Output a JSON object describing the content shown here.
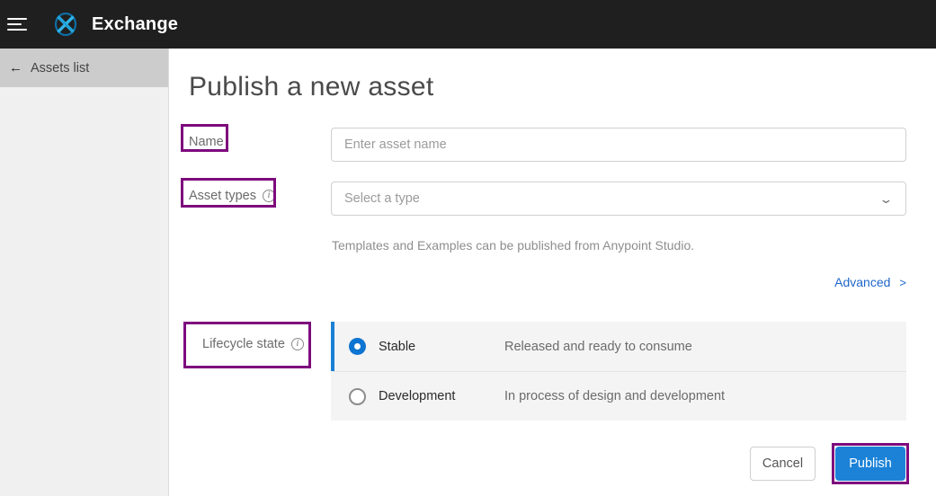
{
  "topbar": {
    "menu_icon": "hamburger-menu-icon",
    "logo_icon": "exchange-logo-icon",
    "title": "Exchange",
    "bg_color": "#1f1f1f"
  },
  "sidebar": {
    "back_icon": "arrow-left-icon",
    "items": [
      {
        "label": "Assets list",
        "active": true
      }
    ]
  },
  "main": {
    "page_title": "Publish a new asset",
    "fields": {
      "name": {
        "label": "Name",
        "placeholder": "Enter asset name",
        "value": ""
      },
      "asset_types": {
        "label": "Asset types",
        "info_icon": "info-circle-icon",
        "placeholder": "Select a type",
        "value": "",
        "chevron_icon": "chevron-down-icon"
      }
    },
    "helper_text": "Templates and Examples can be published from Anypoint Studio.",
    "advanced": {
      "label": "Advanced",
      "caret": ">",
      "color": "#1f66c9"
    },
    "lifecycle": {
      "label": "Lifecycle state",
      "info_icon": "info-circle-icon",
      "options": [
        {
          "name": "Stable",
          "description": "Released and ready to consume",
          "selected": true
        },
        {
          "name": "Development",
          "description": "In process of design and development",
          "selected": false
        }
      ],
      "accent_color": "#0d74d1"
    },
    "buttons": {
      "cancel": "Cancel",
      "publish": "Publish",
      "publish_color": "#1b82d8"
    }
  },
  "annotations": {
    "highlight_color": "#7d0a7d",
    "boxes": [
      "name-label-highlight",
      "asset-types-label-highlight",
      "lifecycle-state-label-highlight",
      "publish-button-highlight"
    ]
  }
}
